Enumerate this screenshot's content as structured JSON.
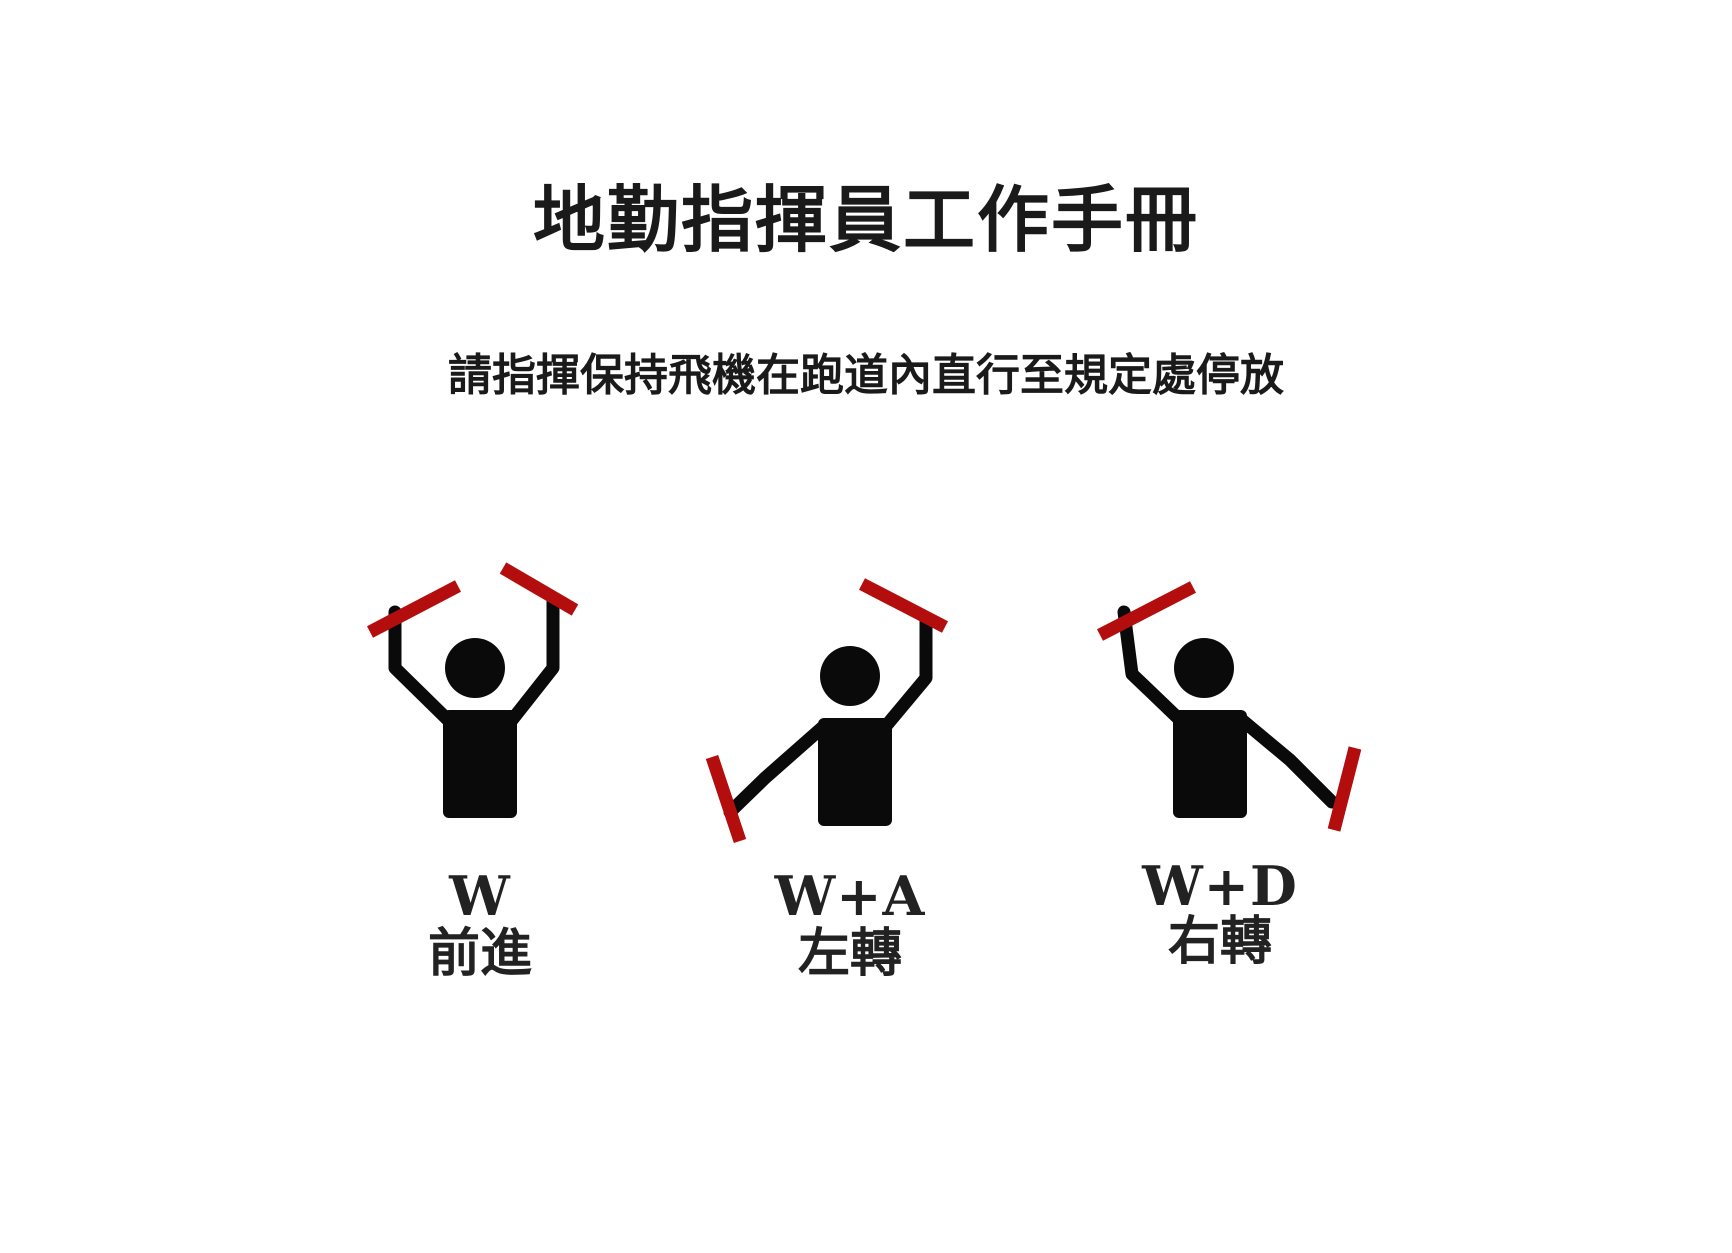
{
  "manual": {
    "title": "地勤指揮員工作手冊",
    "instruction": "請指揮保持飛機在跑道內直行至規定處停放"
  },
  "signals": [
    {
      "key": "W",
      "action": "前進",
      "pose": "both-wands-raised"
    },
    {
      "key": "W+A",
      "action": "左轉",
      "pose": "left-wand-low-right-wand-raised"
    },
    {
      "key": "W+D",
      "action": "右轉",
      "pose": "left-wand-raised-right-wand-low"
    }
  ],
  "colors": {
    "wand": "#b30d0d",
    "figure": "#0a0a0a",
    "text": "#1a1a1a",
    "background": "#ffffff"
  }
}
